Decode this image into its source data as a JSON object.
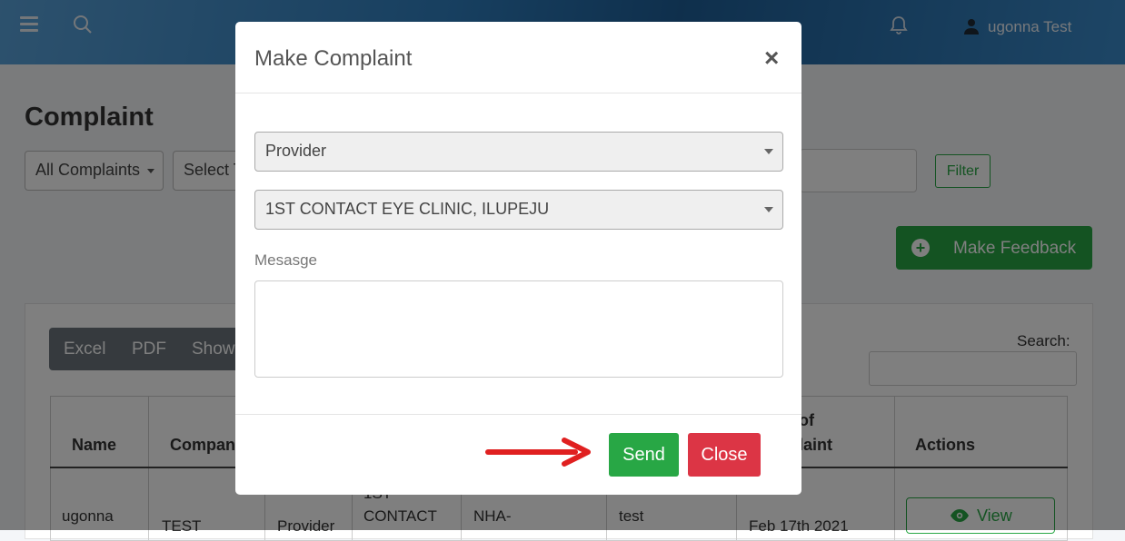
{
  "header": {
    "user_name": "ugonna Test"
  },
  "page": {
    "title": "Complaint",
    "filter_all": "All Complaints",
    "filter_type": "Select T",
    "filter_button": "Filter",
    "feedback_button": "Make Feedback",
    "export": {
      "excel": "Excel",
      "pdf": "PDF",
      "show": "Show"
    },
    "search_label": "Search:",
    "table": {
      "headers": {
        "name": "Name",
        "company": "Company",
        "date_line1": "of",
        "date_line2": "laint",
        "actions": "Actions"
      },
      "row": {
        "name": "ugonna",
        "company": "TEST",
        "type": "Provider",
        "provider_line1": "1ST",
        "provider_line2": "CONTACT",
        "code": "NHA-",
        "message": "test",
        "date": "Feb 17th 2021",
        "view_label": "View"
      }
    }
  },
  "modal": {
    "title": "Make Complaint",
    "close_symbol": "×",
    "type_select": "Provider",
    "provider_select": "1ST CONTACT EYE CLINIC, ILUPEJU",
    "message_label": "Mesasge",
    "send_label": "Send",
    "close_label": "Close"
  },
  "colors": {
    "primary_green": "#28a745",
    "danger_red": "#dc3545",
    "annotation_arrow": "#e02020"
  },
  "icons": [
    "hamburger-icon",
    "search-icon",
    "bell-icon",
    "user-icon",
    "plus-circle-icon",
    "eye-icon",
    "close-icon",
    "arrow-icon"
  ]
}
